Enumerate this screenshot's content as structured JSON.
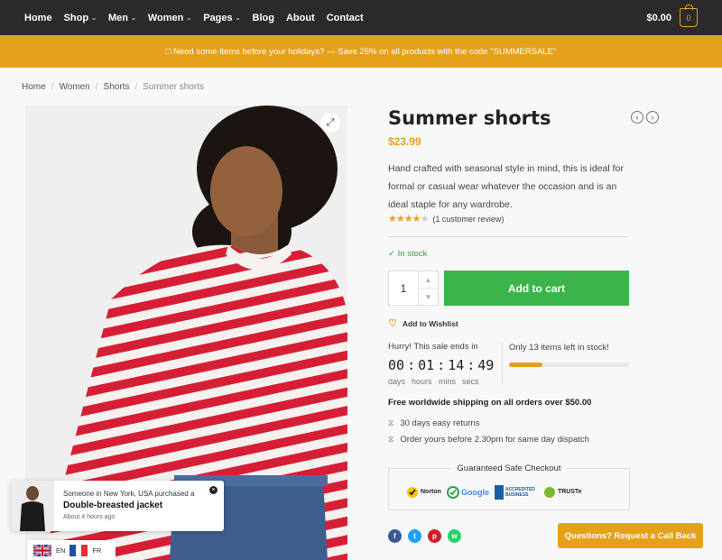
{
  "nav": {
    "items": [
      {
        "label": "Home",
        "has_menu": false
      },
      {
        "label": "Shop",
        "has_menu": true
      },
      {
        "label": "Men",
        "has_menu": true
      },
      {
        "label": "Women",
        "has_menu": true
      },
      {
        "label": "Pages",
        "has_menu": true
      },
      {
        "label": "Blog",
        "has_menu": false
      },
      {
        "label": "About",
        "has_menu": false
      },
      {
        "label": "Contact",
        "has_menu": false
      }
    ],
    "cart_total": "$0.00",
    "cart_count": "0"
  },
  "promo": {
    "text": "□ Need some items before your holidays? — Save 25% on all products with the code \"SUMMERSALE\""
  },
  "breadcrumb": [
    "Home",
    "Women",
    "Shorts",
    "Summer shorts"
  ],
  "product": {
    "title": "Summer shorts",
    "price": "$23.99",
    "description": "Hand crafted with seasonal style in mind, this is ideal for formal or casual wear whatever the occasion and is an ideal staple for any wardrobe.",
    "rating": 4.5,
    "review_text": "(1 customer review)",
    "stock": "✓  In stock",
    "quantity": "1",
    "add_to_cart": "Add to cart",
    "wishlist": "Add to Wishlist"
  },
  "countdown": {
    "title": "Hurry! This sale ends in",
    "days": "00",
    "hours": "01",
    "mins": "14",
    "secs": "49",
    "label_days": "days",
    "label_hours": "hours",
    "label_mins": "mins",
    "label_secs": "secs"
  },
  "stock_meter": {
    "text": "Only 13 items left in stock!",
    "fraction": 0.28
  },
  "shipping": {
    "headline": "Free worldwide shipping on all orders over $50.00",
    "features": [
      "30 days easy returns",
      "Order yours before 2.30pm for same day dispatch"
    ]
  },
  "checkout": {
    "title": "Guaranteed Safe Checkout",
    "badges": [
      "Norton",
      "Google",
      "ACCREDITED BUSINESS",
      "TRUSTe"
    ]
  },
  "social": [
    {
      "icon": "facebook-icon",
      "glyph": "f",
      "color": "#3b5998"
    },
    {
      "icon": "twitter-icon",
      "glyph": "t",
      "color": "#1da1f2"
    },
    {
      "icon": "pinterest-icon",
      "glyph": "p",
      "color": "#cb2027"
    },
    {
      "icon": "whatsapp-icon",
      "glyph": "w",
      "color": "#25d366"
    }
  ],
  "callback": "Questions? Request a Call Back",
  "purchase_popup": {
    "line1": "Someone in New York, USA purchased a",
    "product": "Double-breasted jacket",
    "ago": "About 4 hours ago"
  },
  "languages": [
    {
      "code": "EN",
      "flag": "uk"
    },
    {
      "code": "FR",
      "flag": "fr"
    }
  ],
  "colors": {
    "accent": "#e6a11b",
    "success": "#3bb54a",
    "nav_bg": "#2b2b2b"
  }
}
